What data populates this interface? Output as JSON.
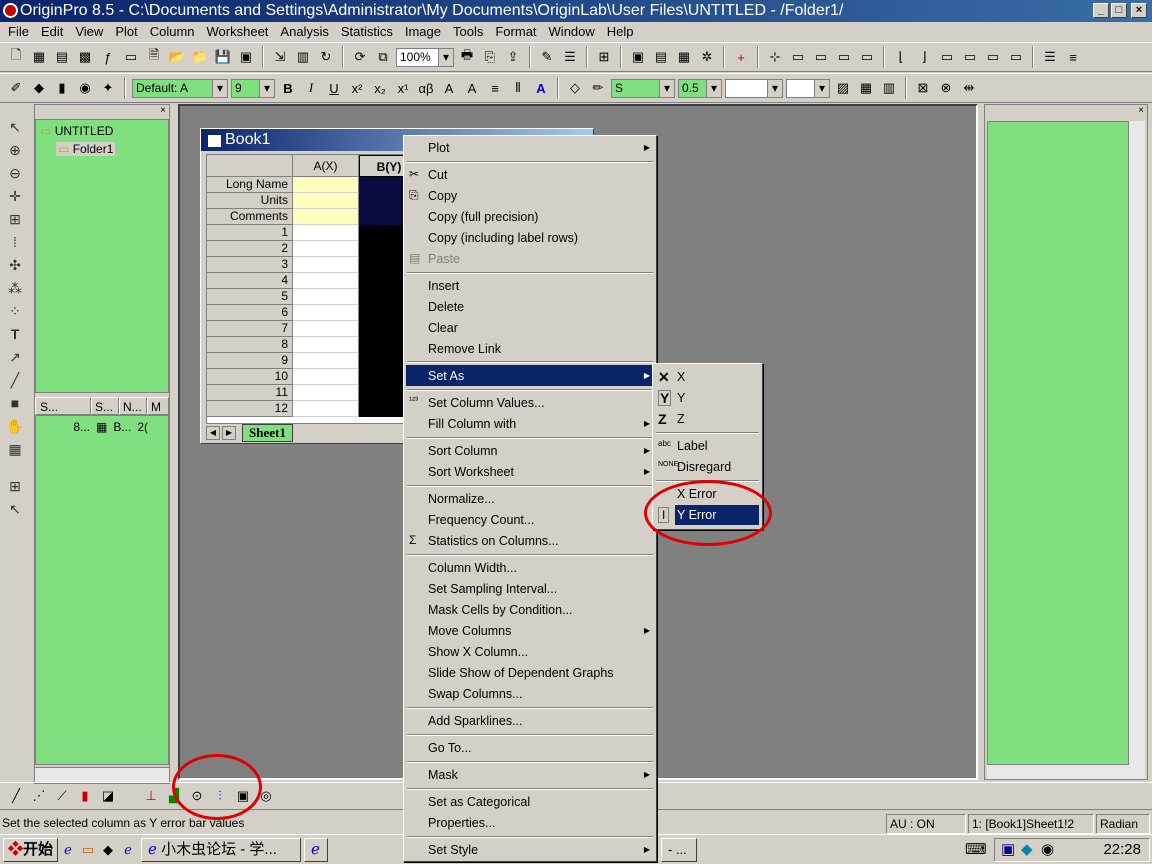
{
  "window": {
    "title": "OriginPro 8.5 - C:\\Documents and Settings\\Administrator\\My Documents\\OriginLab\\User Files\\UNTITLED - /Folder1/",
    "min": "_",
    "max": "□",
    "close": "×"
  },
  "menubar": [
    "File",
    "Edit",
    "View",
    "Plot",
    "Column",
    "Worksheet",
    "Analysis",
    "Statistics",
    "Image",
    "Tools",
    "Format",
    "Window",
    "Help"
  ],
  "toolbar": {
    "zoom": "100%",
    "font_name": "Default: A",
    "font_size": "9",
    "bold": "B",
    "italic": "I",
    "underline": "U",
    "line_width": "0.5",
    "line_style": "S"
  },
  "project_explorer": {
    "root": "UNTITLED",
    "folder": "Folder1",
    "columns": [
      "S...",
      "S...",
      "N...",
      "M"
    ],
    "row": [
      "8...",
      "B...",
      "2("
    ]
  },
  "book": {
    "title": "Book1",
    "col_a": "A(X)",
    "col_b": "B(Y)",
    "row_labels": [
      "Long Name",
      "Units",
      "Comments"
    ],
    "rows": [
      "1",
      "2",
      "3",
      "4",
      "5",
      "6",
      "7",
      "8",
      "9",
      "10",
      "11",
      "12"
    ],
    "sheet": "Sheet1"
  },
  "context_menu": {
    "items": [
      "Plot",
      "Cut",
      "Copy",
      "Copy (full precision)",
      "Copy (including label rows)",
      "Paste",
      "Insert",
      "Delete",
      "Clear",
      "Remove Link",
      "Set As",
      "Set Column Values...",
      "Fill Column with",
      "Sort Column",
      "Sort Worksheet",
      "Normalize...",
      "Frequency Count...",
      "Statistics on Columns...",
      "Column Width...",
      "Set Sampling Interval...",
      "Mask Cells by Condition...",
      "Move Columns",
      "Show X Column...",
      "Slide Show of Dependent Graphs",
      "Swap Columns...",
      "Add Sparklines...",
      "Go To...",
      "Mask",
      "Set as Categorical",
      "Properties...",
      "Set Style"
    ]
  },
  "submenu": {
    "items": [
      "X",
      "Y",
      "Z",
      "Label",
      "Disregard",
      "X Error",
      "Y Error"
    ]
  },
  "status": {
    "text": "Set the selected column as Y error bar values",
    "au": "AU : ON",
    "cell": "1: [Book1]Sheet1!2",
    "angle": "Radian"
  },
  "taskbar": {
    "start": "开始",
    "task1": "小木虫论坛 - 学...",
    "task2": "... ",
    "task3": "- ...",
    "clock": "22:28"
  },
  "colors": {
    "title_blue": "#0a246a",
    "pane_green": "#80e080",
    "highlight": "#0a246a",
    "annotation_red": "#e00000"
  }
}
